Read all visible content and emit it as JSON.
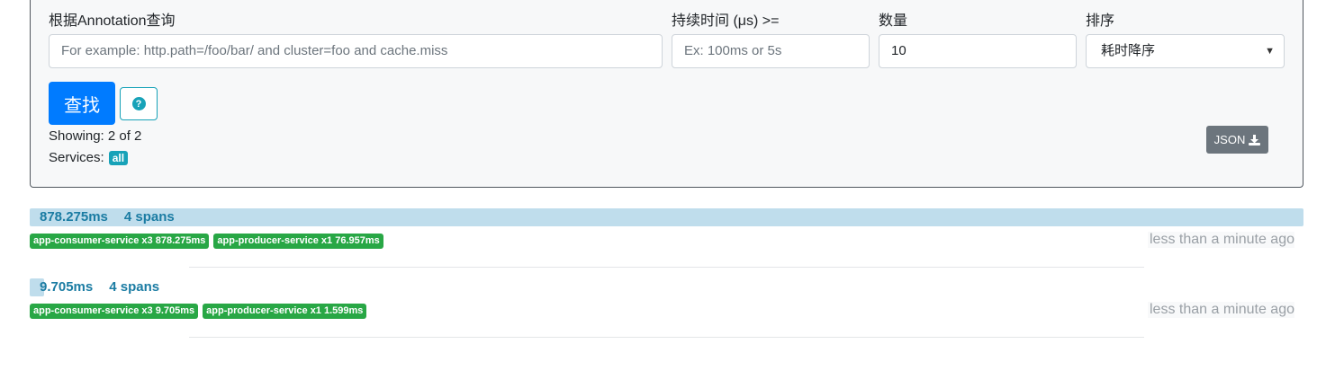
{
  "search": {
    "annotation_label": "根据Annotation查询",
    "annotation_placeholder": "For example: http.path=/foo/bar/ and cluster=foo and cache.miss",
    "duration_label": "持续时间 (μs) >=",
    "duration_placeholder": "Ex: 100ms or 5s",
    "limit_label": "数量",
    "limit_value": "10",
    "sort_label": "排序",
    "sort_value": "耗时降序",
    "search_button": "查找",
    "help_glyph": "?",
    "showing": "Showing: 2 of 2",
    "services_label": "Services:",
    "services_badge": "all",
    "json_button": "JSON"
  },
  "traces": [
    {
      "duration": "878.275ms",
      "spans": "4 spans",
      "bar_fraction": 1.0,
      "services": [
        "app-consumer-service x3 878.275ms",
        "app-producer-service x1 76.957ms"
      ],
      "time": "less than a minute ago"
    },
    {
      "duration": "9.705ms",
      "spans": "4 spans",
      "bar_fraction": 0.011,
      "services": [
        "app-consumer-service x3 9.705ms",
        "app-producer-service x1 1.599ms"
      ],
      "time": "less than a minute ago"
    }
  ],
  "colors": {
    "primary": "#007bff",
    "info": "#17a2b8",
    "success": "#28a745",
    "secondary": "#6c757d",
    "bar": "#bfddec",
    "bar_text": "#1b7ca3"
  },
  "icons": {
    "help": "question-circle-icon",
    "json": "download-icon",
    "select": "caret-down-icon"
  }
}
